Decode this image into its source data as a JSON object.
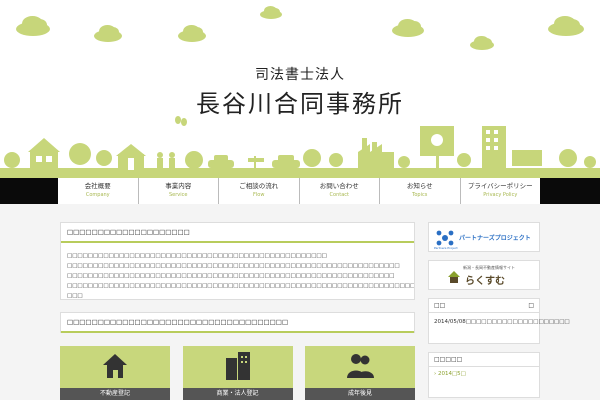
{
  "site": {
    "subtitle": "司法書士法人",
    "title": "長谷川合同事務所"
  },
  "nav": [
    {
      "label": "会社概要",
      "en": "Company"
    },
    {
      "label": "事業内容",
      "en": "Service"
    },
    {
      "label": "ご相談の流れ",
      "en": "Flow"
    },
    {
      "label": "お問い合わせ",
      "en": "Contact"
    },
    {
      "label": "お知らせ",
      "en": "Topics"
    },
    {
      "label": "プライバシーポリシー",
      "en": "Privacy Policy"
    }
  ],
  "main": {
    "greeting_title": "□□□□□□□□□□□□□□□□□□□□",
    "greeting_lines": [
      "□□□□□□□□□□□□□□□□□□□□□□□□□□□□□□□□□□□□□□□□□□□□□□□□□□",
      "□□□□□□□□□□□□□□□□□□□□□□□□□□□□□□□□□□□□□□□□□□□□□□□□□□□□□□□□□□□□□□□□",
      "□□□□□□□□□□□□□□□□□□□□□□□□□□□□□□□□□□□□□□□□□□□□□□□□□□□□□□□□□□□□□□□",
      "□□□□□□□□□□□□□□□□□□□□□□□□□□□□□□□□□□□□□□□□□□□□□□□□□□□□□□□□□□□□□□□□□□□ □□□"
    ],
    "services_title": "□□□□□□□□□□□□□□□□□□□□□□□□□□□□□□□□□□□□",
    "services": [
      {
        "label": "不動産登記"
      },
      {
        "label": "商業・法人登記"
      },
      {
        "label": "成年後見"
      }
    ]
  },
  "sidebar": {
    "partner_banner": "パートナーズプロジェクト",
    "partner_sub": "Partners Project",
    "rakusumu_caption": "新潟・長岡不動産情報サイト",
    "rakusumu_name": "らくすむ",
    "news_widget": {
      "title": "□□",
      "close": "□",
      "entry": "2014/05/08□□□□□□□□□□□□□□□□□□□□"
    },
    "archive_widget": {
      "title": "□□□□□",
      "entry": "2014□5□"
    }
  },
  "colors": {
    "accent_green": "#b8cc5c",
    "cloud_green": "#c7d67a",
    "nav_bar": "#0a0a0a"
  }
}
